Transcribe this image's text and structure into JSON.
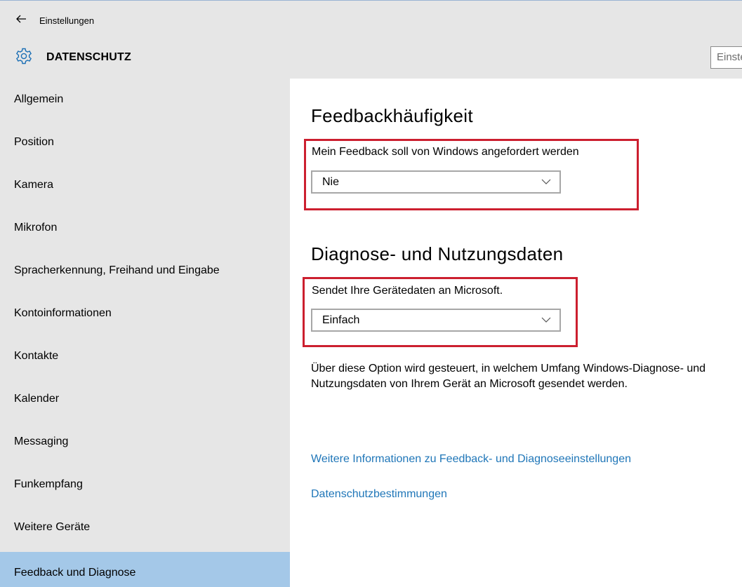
{
  "window": {
    "back_icon": "arrow-left-icon",
    "title": "Einstellungen"
  },
  "header": {
    "icon": "gear-icon",
    "title": "DATENSCHUTZ",
    "search_placeholder": "Einstellung suchen"
  },
  "sidebar": {
    "items": [
      {
        "label": "Allgemein"
      },
      {
        "label": "Position"
      },
      {
        "label": "Kamera"
      },
      {
        "label": "Mikrofon"
      },
      {
        "label": "Spracherkennung, Freihand und Eingabe"
      },
      {
        "label": "Kontoinformationen"
      },
      {
        "label": "Kontakte"
      },
      {
        "label": "Kalender"
      },
      {
        "label": "Messaging"
      },
      {
        "label": "Funkempfang"
      },
      {
        "label": "Weitere Geräte"
      },
      {
        "label": "Feedback und Diagnose",
        "selected": true
      }
    ],
    "selected_color": "#a4c8e8"
  },
  "feedback": {
    "heading": "Feedbackhäufigkeit",
    "label": "Mein Feedback soll von Windows angefordert werden",
    "value": "Nie"
  },
  "diagnostics": {
    "heading": "Diagnose- und Nutzungsdaten",
    "label": "Sendet Ihre Gerätedaten an Microsoft.",
    "value": "Einfach",
    "description": "Über diese Option wird gesteuert, in welchem Umfang Windows-Diagnose- und Nutzungsdaten von Ihrem Gerät an Microsoft gesendet werden."
  },
  "links": {
    "more_info": "Weitere Informationen zu Feedback- und Diagnoseeinstellungen",
    "privacy": "Datenschutzbestimmungen"
  },
  "colors": {
    "highlight_box": "#cc1f2f",
    "link": "#1f76b8",
    "sidebar_bg": "#e6e6e6"
  }
}
